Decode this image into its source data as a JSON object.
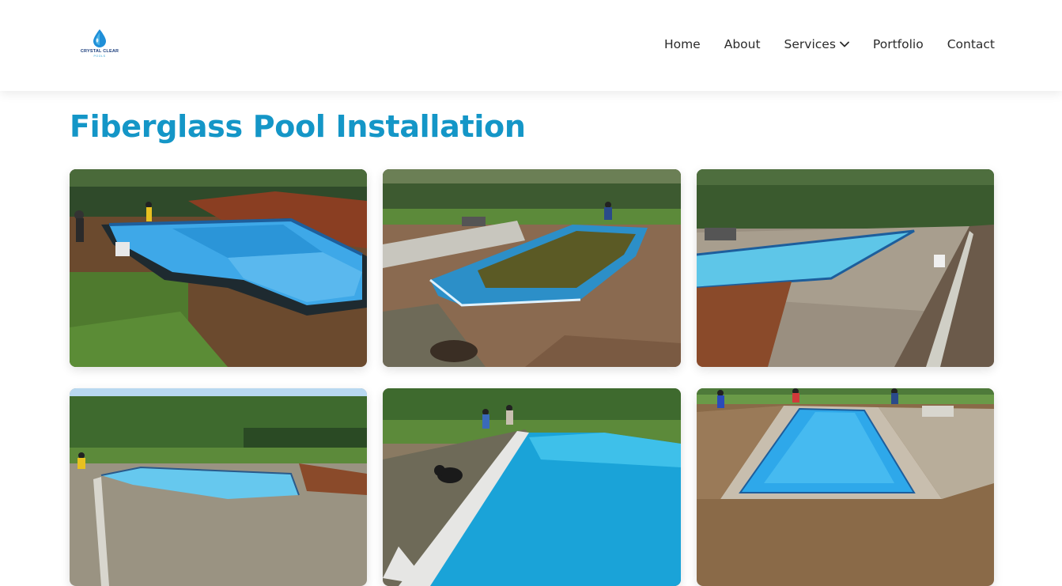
{
  "logo": {
    "brand": "CRYSTAL CLEAR",
    "sub": "POOLS"
  },
  "nav": {
    "items": [
      {
        "label": "Home"
      },
      {
        "label": "About"
      },
      {
        "label": "Services"
      },
      {
        "label": "Portfolio"
      },
      {
        "label": "Contact"
      }
    ]
  },
  "page": {
    "title": "Fiberglass Pool Installation"
  },
  "gallery": {
    "photos": [
      {
        "subject": "pool-shell-in-excavation"
      },
      {
        "subject": "pool-filled-green-water"
      },
      {
        "subject": "pool-with-gravel-surround"
      },
      {
        "subject": "pool-with-hedge-background"
      },
      {
        "subject": "pool-with-cover-and-dog"
      },
      {
        "subject": "pool-with-paving"
      }
    ]
  },
  "colors": {
    "accent": "#1496c7",
    "logo_dark": "#1a3d7c",
    "logo_light": "#2a9fd6"
  }
}
